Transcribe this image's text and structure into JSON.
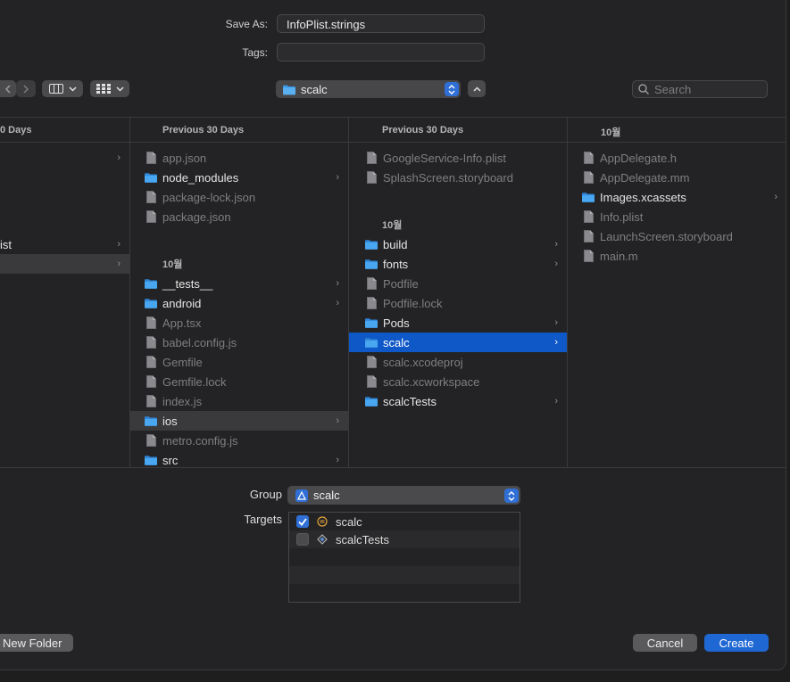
{
  "form": {
    "save_as_label": "Save As:",
    "save_as_value": "InfoPlist.strings",
    "tags_label": "Tags:",
    "tags_value": ""
  },
  "toolbar": {
    "location": "scalc",
    "search_placeholder": "Search"
  },
  "columns": [
    {
      "header": "0 Days",
      "items": [
        {
          "name": "",
          "kind": "folder-partial"
        },
        {
          "name": "ist",
          "kind": "partial"
        },
        {
          "name": "",
          "kind": "partial-highlight"
        }
      ]
    },
    {
      "header": "Previous 30 Days",
      "section": "10월",
      "items_top": [
        {
          "name": "app.json",
          "type": "file",
          "dim": true
        },
        {
          "name": "node_modules",
          "type": "folder",
          "dim": false
        },
        {
          "name": "package-lock.json",
          "type": "file",
          "dim": true
        },
        {
          "name": "package.json",
          "type": "file",
          "dim": true
        }
      ],
      "items_bottom": [
        {
          "name": "__tests__",
          "type": "folder",
          "dim": false
        },
        {
          "name": "android",
          "type": "folder",
          "dim": false
        },
        {
          "name": "App.tsx",
          "type": "file",
          "dim": true
        },
        {
          "name": "babel.config.js",
          "type": "file",
          "dim": true
        },
        {
          "name": "Gemfile",
          "type": "file",
          "dim": true
        },
        {
          "name": "Gemfile.lock",
          "type": "file",
          "dim": true
        },
        {
          "name": "index.js",
          "type": "file",
          "dim": true
        },
        {
          "name": "ios",
          "type": "folder",
          "dim": false
        },
        {
          "name": "metro.config.js",
          "type": "file",
          "dim": true
        },
        {
          "name": "src",
          "type": "folder",
          "dim": false
        }
      ]
    },
    {
      "header": "Previous 30 Days",
      "section": "10월",
      "items_top": [
        {
          "name": "GoogleService-Info.plist",
          "type": "file",
          "dim": true
        },
        {
          "name": "SplashScreen.storyboard",
          "type": "file",
          "dim": true
        }
      ],
      "items_bottom": [
        {
          "name": "build",
          "type": "folder",
          "dim": false
        },
        {
          "name": "fonts",
          "type": "folder",
          "dim": false
        },
        {
          "name": "Podfile",
          "type": "file",
          "dim": true
        },
        {
          "name": "Podfile.lock",
          "type": "file",
          "dim": true
        },
        {
          "name": "Pods",
          "type": "folder",
          "dim": false
        },
        {
          "name": "scalc",
          "type": "folder",
          "dim": false
        },
        {
          "name": "scalc.xcodeproj",
          "type": "file",
          "dim": true
        },
        {
          "name": "scalc.xcworkspace",
          "type": "file",
          "dim": true
        },
        {
          "name": "scalcTests",
          "type": "folder",
          "dim": false
        }
      ]
    },
    {
      "header": "10월",
      "items": [
        {
          "name": "AppDelegate.h",
          "type": "file",
          "dim": true
        },
        {
          "name": "AppDelegate.mm",
          "type": "file",
          "dim": true
        },
        {
          "name": "Images.xcassets",
          "type": "folder",
          "dim": false
        },
        {
          "name": "Info.plist",
          "type": "file",
          "dim": true
        },
        {
          "name": "LaunchScreen.storyboard",
          "type": "file",
          "dim": true
        },
        {
          "name": "main.m",
          "type": "file",
          "dim": true
        }
      ]
    }
  ],
  "options": {
    "group_label": "Group",
    "group_value": "scalc",
    "targets_label": "Targets",
    "targets": [
      {
        "name": "scalc",
        "checked": true
      },
      {
        "name": "scalcTests",
        "checked": false
      }
    ]
  },
  "buttons": {
    "new_folder": "New Folder",
    "cancel": "Cancel",
    "create": "Create"
  },
  "colors": {
    "accent": "#0f58c7",
    "folder": "#3a9ae8"
  }
}
